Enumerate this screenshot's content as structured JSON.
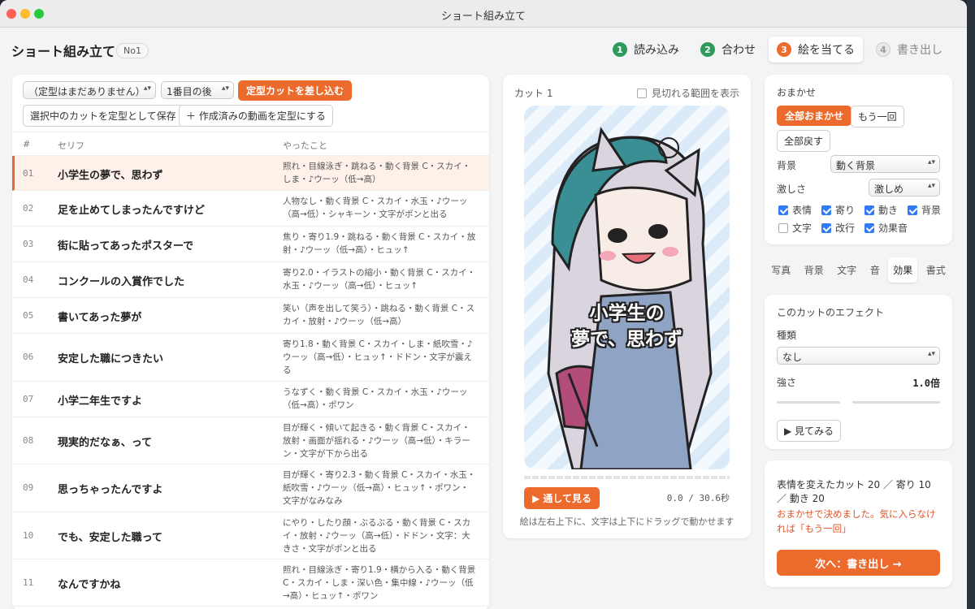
{
  "window": {
    "title": "ショート組み立て"
  },
  "header": {
    "title": "ショート組み立て",
    "badge": "No1"
  },
  "steps": [
    {
      "n": "1",
      "label": "読み込み",
      "state": "done"
    },
    {
      "n": "2",
      "label": "合わせ",
      "state": "done"
    },
    {
      "n": "3",
      "label": "絵を当てる",
      "state": "active"
    },
    {
      "n": "4",
      "label": "書き出し",
      "state": "todo"
    }
  ],
  "toolbar": {
    "template_select": "（定型はまだありません）",
    "position_select": "1番目の後",
    "insert_button": "定型カットを差し込む",
    "save_template_button": "選択中のカットを定型として保存",
    "movie_template_button": "＋ 作成済みの動画を定型にする"
  },
  "table": {
    "headers": [
      "#",
      "セリフ",
      "やったこと"
    ],
    "rows": [
      {
        "num": "01",
        "line": "小学生の夢で、思わず",
        "did": "照れ・目線泳ぎ・跳ねる・動く背景 C・スカイ・しま・♪ウーッ（低→高）"
      },
      {
        "num": "02",
        "line": "足を止めてしまったんですけど",
        "did": "人物なし・動く背景 C・スカイ・水玉・♪ウーッ（高→低）・シャキーン・文字がポンと出る"
      },
      {
        "num": "03",
        "line": "街に貼ってあったポスターで",
        "did": "焦り・寄り1.9・跳ねる・動く背景 C・スカイ・放射・♪ウーッ（低→高）・ヒュッ↑"
      },
      {
        "num": "04",
        "line": "コンクールの入賞作でした",
        "did": "寄り2.0・イラストの縮小・動く背景 C・スカイ・水玉・♪ウーッ（高→低）・ヒュッ↑"
      },
      {
        "num": "05",
        "line": "書いてあった夢が",
        "did": "笑い（声を出して笑う）・跳ねる・動く背景 C・スカイ・放射・♪ウーッ（低→高）"
      },
      {
        "num": "06",
        "line": "安定した職につきたい",
        "did": "寄り1.8・動く背景 C・スカイ・しま・紙吹雪・♪ウーッ（高→低）・ヒュッ↑・ドドン・文字が震える"
      },
      {
        "num": "07",
        "line": "小学二年生ですよ",
        "did": "うなずく・動く背景 C・スカイ・水玉・♪ウーッ（低→高）・ポワン"
      },
      {
        "num": "08",
        "line": "現実的だなぁ、って",
        "did": "目が輝く・傾いて起きる・動く背景 C・スカイ・放射・画面が揺れる・♪ウーッ（高→低）・キラーン・文字が下から出る"
      },
      {
        "num": "09",
        "line": "思っちゃったんですよ",
        "did": "目が輝く・寄り2.3・動く背景 C・スカイ・水玉・紙吹雪・♪ウーッ（低→高）・ヒュッ↑・ポワン・文字がなみなみ"
      },
      {
        "num": "10",
        "line": "でも、安定した職って",
        "did": "にやり・したり顔・ぶるぶる・動く背景 C・スカイ・放射・♪ウーッ（高→低）・ドドン・文字：大きさ・文字がポンと出る"
      },
      {
        "num": "11",
        "line": "なんですかね",
        "did": "照れ・目線泳ぎ・寄り1.9・横から入る・動く背景 C・スカイ・しま・深い色・集中線・♪ウーッ（低→高）・ヒュッ↑・ポワン"
      }
    ]
  },
  "preview": {
    "cut_label": "カット 1",
    "show_range_label": "見切れる範囲を表示",
    "caption_line1": "小学生の",
    "caption_line2": "夢で、思わず",
    "play_button": "▶ 通して見る",
    "time": "0.0 / 30.6秒",
    "hint": "絵は左右上下に、文字は上下にドラッグで動かせます"
  },
  "omakase": {
    "title": "おまかせ",
    "all_button": "全部おまかせ",
    "again_button": "もう一回",
    "reset_button": "全部戻す",
    "bg_label": "背景",
    "bg_value": "動く背景",
    "intensity_label": "激しさ",
    "intensity_value": "激しめ",
    "checks": [
      {
        "label": "表情",
        "on": true
      },
      {
        "label": "寄り",
        "on": true
      },
      {
        "label": "動き",
        "on": true
      },
      {
        "label": "背景",
        "on": true
      },
      {
        "label": "文字",
        "on": false
      },
      {
        "label": "改行",
        "on": true
      },
      {
        "label": "効果音",
        "on": true
      }
    ]
  },
  "tabs": [
    "写真",
    "背景",
    "文字",
    "音",
    "効果",
    "書式"
  ],
  "active_tab": "効果",
  "effect": {
    "title": "このカットのエフェクト",
    "type_label": "種類",
    "type_value": "なし",
    "strength_label": "強さ",
    "strength_value": "1.0倍",
    "preview_button": "▶ 見てみる"
  },
  "summary": {
    "stats": "表情を変えたカット 20 ／ 寄り 10 ／ 動き 20",
    "note": "おまかせで決めました。気に入らなければ「もう一回」",
    "next_button": "次へ：書き出し →"
  },
  "colors": {
    "accent": "#ec6a2b",
    "done": "#2e9a5c",
    "check": "#2f7cf6"
  }
}
